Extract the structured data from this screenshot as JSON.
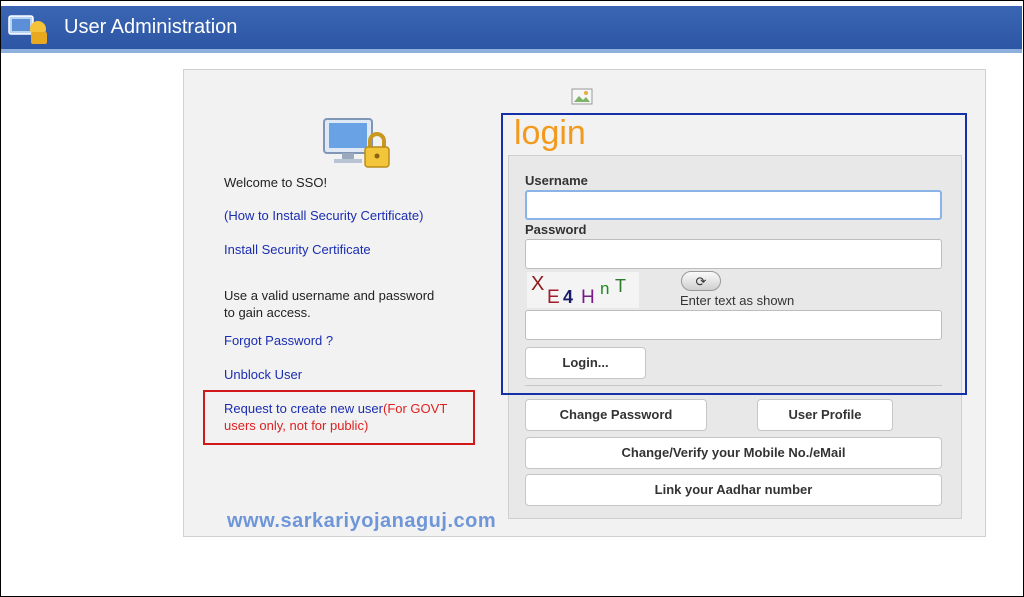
{
  "header": {
    "title": "User Administration",
    "bar_color": "#2d56a4"
  },
  "left": {
    "welcome": "Welcome to SSO!",
    "how_to_link": "(How to Install Security Certificate)",
    "install_link": "Install Security Certificate",
    "use_valid": "Use a valid username and password to gain access.",
    "forgot_link": "Forgot Password ?",
    "unblock_link": "Unblock User",
    "request_link": "Request to create new user",
    "request_note": "(For GOVT users only, not for public)"
  },
  "login": {
    "heading": "login",
    "heading_color": "#f29a1e",
    "username_label": "Username",
    "username_value": "",
    "password_label": "Password",
    "password_value": "",
    "captcha_text": "XE4HnT",
    "captcha_value": "",
    "refresh_icon": "refresh-icon",
    "enter_text": "Enter text as shown",
    "login_button": "Login..."
  },
  "actions": {
    "change_password": "Change Password",
    "user_profile": "User Profile",
    "change_mobile": "Change/Verify your Mobile No./eMail",
    "link_aadhar": "Link your Aadhar number"
  },
  "watermark": "www.sarkariyojanaguj.com"
}
